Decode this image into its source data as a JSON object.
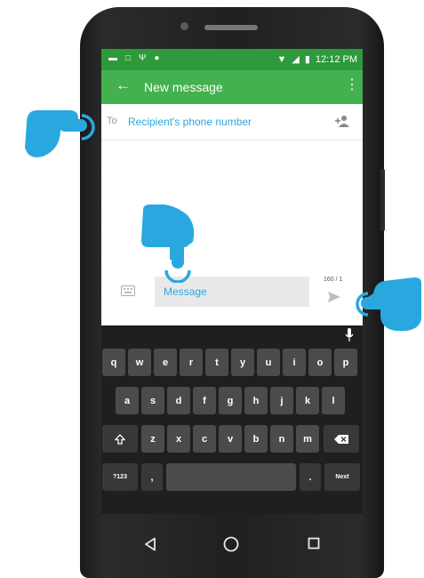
{
  "status_bar": {
    "time": "12:12 PM",
    "left_icons": [
      "notification-icon",
      "message-icon",
      "usb-icon",
      "alert-icon"
    ],
    "right_icons": [
      "wifi-icon",
      "signal-icon",
      "battery-icon"
    ]
  },
  "app_bar": {
    "title": "New message",
    "back_icon": "arrow-left-icon",
    "overflow_icon": "more-vert-icon",
    "color": "#43b14e",
    "status_color": "#2e9a3b"
  },
  "recipient": {
    "label": "To",
    "placeholder": "Recipient's phone number",
    "value": ""
  },
  "compose": {
    "placeholder": "Message",
    "value": "",
    "char_counter": "160 / 1"
  },
  "keyboard": {
    "row1": [
      "q",
      "w",
      "e",
      "r",
      "t",
      "y",
      "u",
      "i",
      "o",
      "p"
    ],
    "row2": [
      "a",
      "s",
      "d",
      "f",
      "g",
      "h",
      "j",
      "k",
      "l"
    ],
    "row3": [
      "z",
      "x",
      "c",
      "v",
      "b",
      "n",
      "m"
    ],
    "symbols_key": "?123",
    "comma_key": ",",
    "period_key": ".",
    "next_key": "Next"
  },
  "navigation": {
    "icons": [
      "back-triangle-icon",
      "home-circle-icon",
      "recents-square-icon"
    ]
  },
  "colors": {
    "accent": "#29a8df",
    "hand": "#29a8df"
  }
}
